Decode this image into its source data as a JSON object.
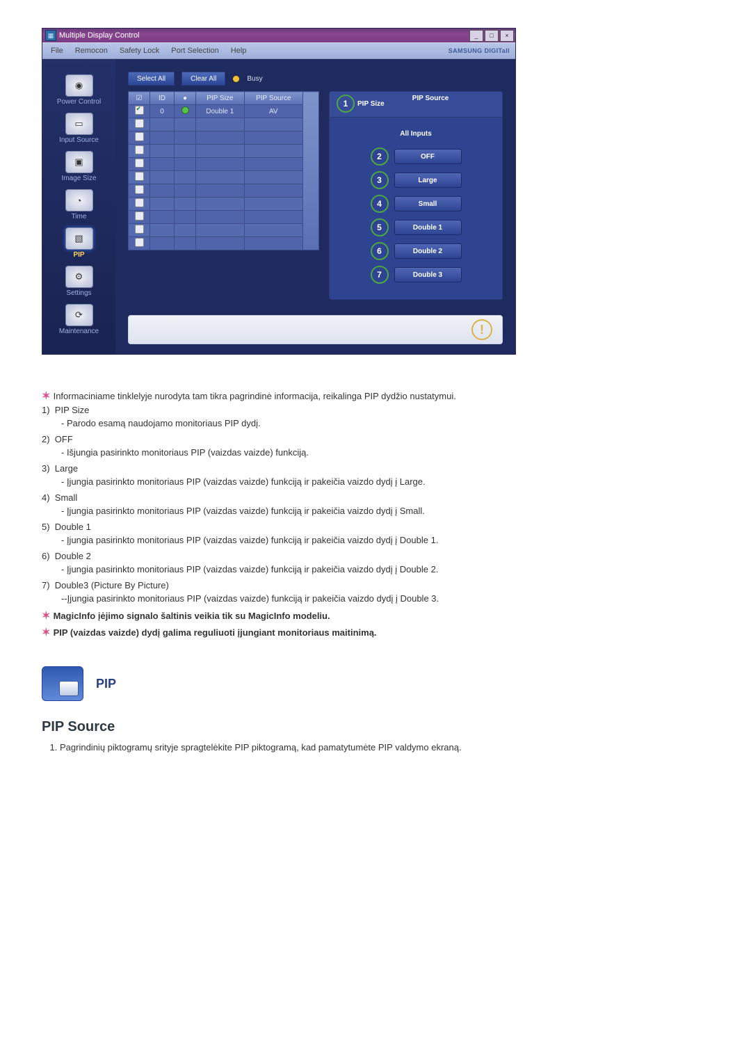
{
  "titlebar": {
    "text": "Multiple Display Control"
  },
  "win_controls": {
    "min": "_",
    "max": "□",
    "close": "×"
  },
  "menubar": {
    "items": [
      "File",
      "Remocon",
      "Safety Lock",
      "Port Selection",
      "Help"
    ],
    "brand": "SAMSUNG DIGITall"
  },
  "sidebar": {
    "items": [
      {
        "label": "Power Control",
        "glyph": "◉"
      },
      {
        "label": "Input Source",
        "glyph": "▭"
      },
      {
        "label": "Image Size",
        "glyph": "▣"
      },
      {
        "label": "Time",
        "glyph": "◔"
      },
      {
        "label": "PIP",
        "glyph": "▧",
        "selected": true
      },
      {
        "label": "Settings",
        "glyph": "⚙"
      },
      {
        "label": "Maintenance",
        "glyph": "⟳"
      }
    ]
  },
  "toolbar": {
    "select_all": "Select All",
    "clear_all": "Clear All",
    "busy": "Busy"
  },
  "table": {
    "headers": {
      "chk": "☑",
      "id": "ID",
      "status": "●",
      "pip_size": "PIP Size",
      "pip_source": "PIP Source"
    },
    "rows": [
      {
        "checked": true,
        "id": "0",
        "status": true,
        "pip_size": "Double 1",
        "pip_source": "AV"
      },
      {
        "checked": false
      },
      {
        "checked": false
      },
      {
        "checked": false
      },
      {
        "checked": false
      },
      {
        "checked": false
      },
      {
        "checked": false
      },
      {
        "checked": false
      },
      {
        "checked": false
      },
      {
        "checked": false
      },
      {
        "checked": false
      }
    ]
  },
  "right_panel": {
    "head_num": "1",
    "head_a": "PIP Size",
    "head_b": "PIP Source",
    "subtitle": "All Inputs",
    "options": [
      {
        "num": "2",
        "label": "OFF"
      },
      {
        "num": "3",
        "label": "Large"
      },
      {
        "num": "4",
        "label": "Small"
      },
      {
        "num": "5",
        "label": "Double 1"
      },
      {
        "num": "6",
        "label": "Double 2"
      },
      {
        "num": "7",
        "label": "Double 3"
      }
    ]
  },
  "doc": {
    "intro": "Informaciniame tinklelyje nurodyta tam tikra pagrindinė informacija, reikalinga PIP dydžio nustatymui.",
    "items": [
      {
        "n": "1)",
        "title": "PIP Size",
        "desc": "- Parodo esamą naudojamo monitoriaus PIP dydį."
      },
      {
        "n": "2)",
        "title": "OFF",
        "desc": "- Išjungia pasirinkto monitoriaus PIP (vaizdas vaizde) funkciją."
      },
      {
        "n": "3)",
        "title": "Large",
        "desc": "- Įjungia pasirinkto monitoriaus PIP (vaizdas vaizde) funkciją ir pakeičia vaizdo dydį į Large."
      },
      {
        "n": "4)",
        "title": "Small",
        "desc": "- Įjungia pasirinkto monitoriaus PIP (vaizdas vaizde) funkciją ir pakeičia vaizdo dydį į Small."
      },
      {
        "n": "5)",
        "title": "Double 1",
        "desc": "- Įjungia pasirinkto monitoriaus PIP (vaizdas vaizde) funkciją ir pakeičia vaizdo dydį į Double 1."
      },
      {
        "n": "6)",
        "title": "Double 2",
        "desc": "- Įjungia pasirinkto monitoriaus PIP (vaizdas vaizde) funkciją ir pakeičia vaizdo dydį į Double 2."
      },
      {
        "n": "7)",
        "title": "Double3 (Picture By Picture)",
        "desc": "--Įjungia pasirinkto monitoriaus PIP (vaizdas vaizde) funkciją ir pakeičia vaizdo dydį į Double 3."
      }
    ],
    "note1": "MagicInfo įėjimo signalo šaltinis veikia tik su MagicInfo modeliu.",
    "note2": "PIP (vaizdas vaizde) dydį galima reguliuoti įjungiant monitoriaus maitinimą.",
    "pip_title": "PIP",
    "section_title": "PIP Source",
    "step1": "Pagrindinių piktogramų srityje spragtelėkite PIP piktogramą, kad pamatytumėte PIP valdymo ekraną."
  }
}
